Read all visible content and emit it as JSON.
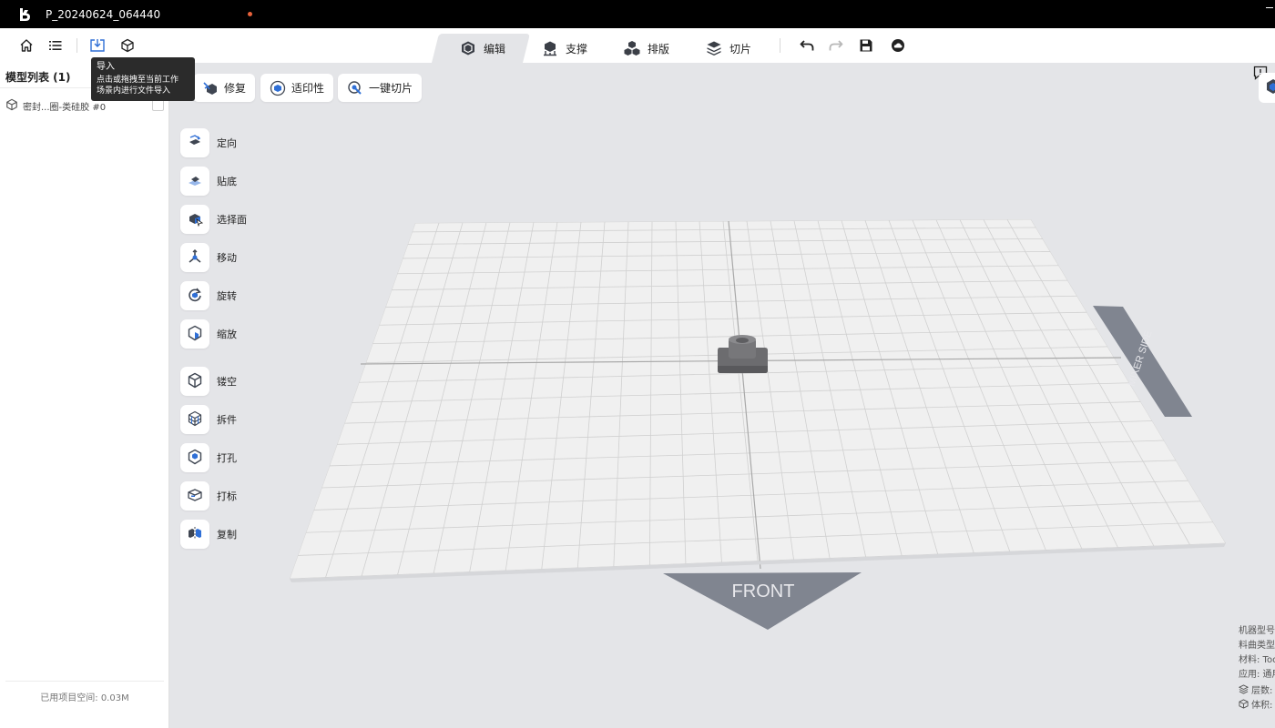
{
  "window": {
    "title": "P_20240624_064440"
  },
  "tabs": [
    {
      "label": "编辑",
      "icon": "edit-cube-icon"
    },
    {
      "label": "支撑",
      "icon": "support-icon"
    },
    {
      "label": "排版",
      "icon": "layout-icon"
    },
    {
      "label": "切片",
      "icon": "slice-icon"
    }
  ],
  "left_panel": {
    "header": "模型列表 (1)",
    "models": [
      {
        "name": "密封...圈-类硅胶 #0"
      }
    ],
    "footer": "已用项目空间: 0.03M"
  },
  "tooltip": {
    "title": "导入",
    "body_line1": "点击或拖拽至当前工作",
    "body_line2": "场景内进行文件导入"
  },
  "actions": [
    {
      "label": "修复"
    },
    {
      "label": "适印性"
    },
    {
      "label": "一键切片"
    }
  ],
  "tools": [
    {
      "label": "定向",
      "icon": "orient-icon"
    },
    {
      "label": "贴底",
      "icon": "lay-flat-icon"
    },
    {
      "label": "选择面",
      "icon": "select-face-icon"
    },
    {
      "label": "移动",
      "icon": "move-icon"
    },
    {
      "label": "旋转",
      "icon": "rotate-icon"
    },
    {
      "label": "缩放",
      "icon": "scale-icon"
    },
    {
      "label": "镂空",
      "icon": "hollow-icon"
    },
    {
      "label": "拆件",
      "icon": "split-icon"
    },
    {
      "label": "打孔",
      "icon": "punch-hole-icon"
    },
    {
      "label": "打标",
      "icon": "label-icon"
    },
    {
      "label": "复制",
      "icon": "duplicate-icon"
    }
  ],
  "scene": {
    "front_label": "FRONT",
    "side_label": "MIXER SIDE"
  },
  "info": {
    "machine": "机器型号:",
    "curve": "料曲类型:",
    "material": "材料:  Too",
    "application": "应用:  通用",
    "layers": "层数:",
    "volume": "体积:"
  },
  "colors": {
    "accent": "#2f6fd6",
    "titlebar": "#000000",
    "plate": "#f0f0f0",
    "grid": "#d0d0d0",
    "marker": "#808590"
  }
}
